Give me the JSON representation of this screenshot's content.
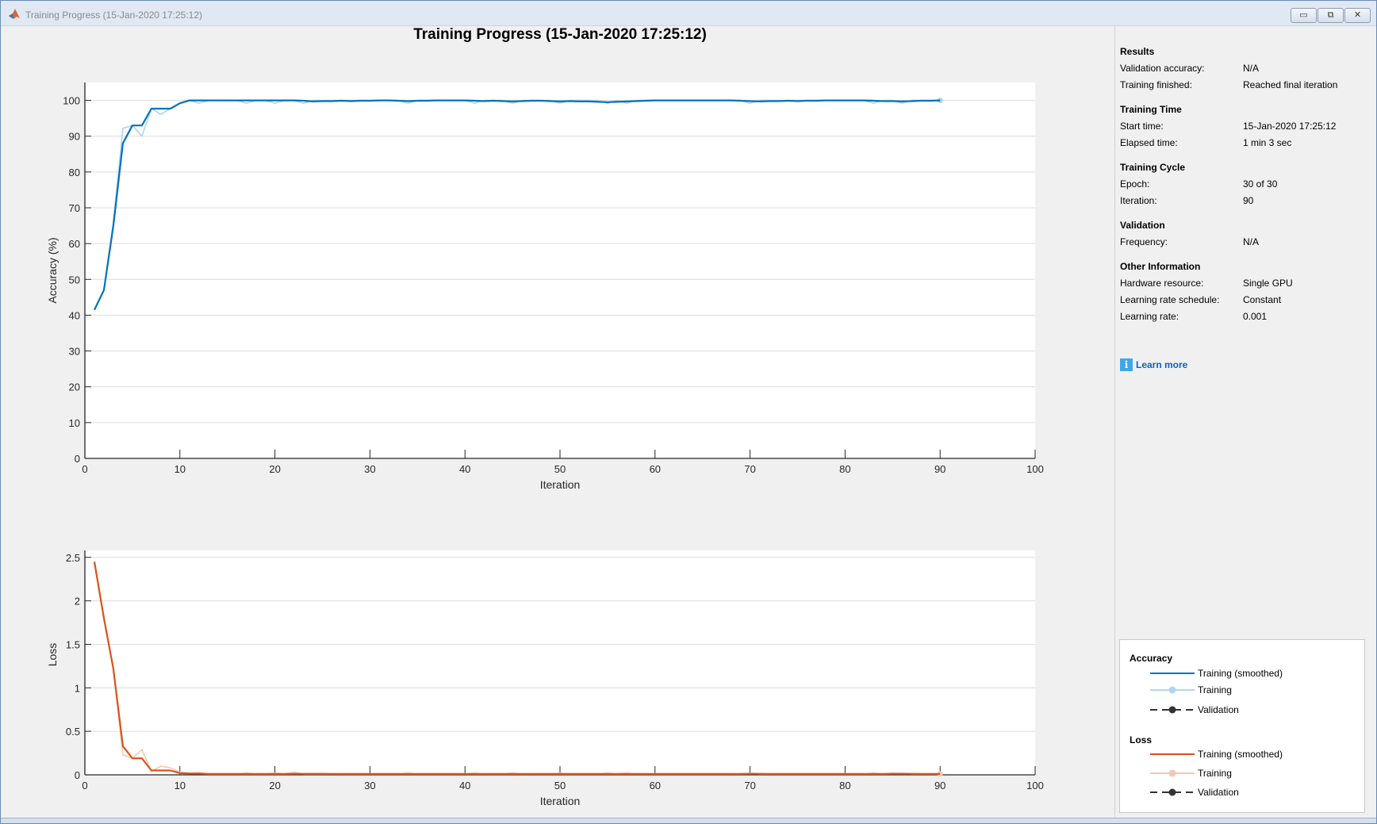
{
  "window": {
    "title": "Training Progress (15-Jan-2020 17:25:12)",
    "buttons": {
      "minimize": "▭",
      "restore": "⧉",
      "close": "✕"
    }
  },
  "main_title": "Training Progress (15-Jan-2020 17:25:12)",
  "info": {
    "sections": [
      {
        "title": "Results",
        "rows": [
          {
            "label": "Validation accuracy:",
            "value": "N/A"
          },
          {
            "label": "Training finished:",
            "value": "Reached final iteration"
          }
        ]
      },
      {
        "title": "Training Time",
        "rows": [
          {
            "label": "Start time:",
            "value": "15-Jan-2020 17:25:12"
          },
          {
            "label": "Elapsed time:",
            "value": "1 min 3 sec"
          }
        ]
      },
      {
        "title": "Training Cycle",
        "rows": [
          {
            "label": "Epoch:",
            "value": "30 of 30"
          },
          {
            "label": "Iteration:",
            "value": "90"
          }
        ]
      },
      {
        "title": "Validation",
        "rows": [
          {
            "label": "Frequency:",
            "value": "N/A"
          }
        ]
      },
      {
        "title": "Other Information",
        "rows": [
          {
            "label": "Hardware resource:",
            "value": "Single GPU"
          },
          {
            "label": "Learning rate schedule:",
            "value": "Constant"
          },
          {
            "label": "Learning rate:",
            "value": "0.001"
          }
        ]
      }
    ],
    "learn_more": "Learn more"
  },
  "legend": {
    "accuracy": {
      "title": "Accuracy",
      "items": [
        "Training (smoothed)",
        "Training",
        "Validation"
      ]
    },
    "loss": {
      "title": "Loss",
      "items": [
        "Training (smoothed)",
        "Training",
        "Validation"
      ]
    }
  },
  "colors": {
    "acc_smooth": "#0072bd",
    "acc_raw": "#b3d4ec",
    "loss_smooth": "#d95319",
    "loss_raw": "#f4c7b2",
    "validation": "#333333"
  },
  "chart_data": [
    {
      "type": "line",
      "xlabel": "Iteration",
      "ylabel": "Accuracy (%)",
      "xlim": [
        0,
        100
      ],
      "ylim": [
        0,
        105
      ],
      "xticks": [
        0,
        10,
        20,
        30,
        40,
        50,
        60,
        70,
        80,
        90,
        100
      ],
      "yticks": [
        0,
        10,
        20,
        30,
        40,
        50,
        60,
        70,
        80,
        90,
        100
      ],
      "grid": "horizontal",
      "series": [
        {
          "name": "Training",
          "color_key": "acc_raw",
          "x_start": 1,
          "values": [
            41.5,
            47,
            66,
            92.2,
            93,
            90,
            97.7,
            96.1,
            97.7,
            99.2,
            100,
            99.2,
            100,
            100,
            100,
            100,
            99.2,
            100,
            100,
            99.2,
            100,
            100,
            99.2,
            100,
            100,
            100,
            100,
            100,
            100,
            100,
            100,
            100,
            100,
            99.2,
            100,
            100,
            100,
            100,
            100,
            100,
            99.2,
            100,
            100,
            100,
            99.2,
            100,
            100,
            100,
            100,
            99.2,
            100,
            100,
            100,
            100,
            99.2,
            100,
            99.2,
            100,
            100,
            100,
            100,
            100,
            100,
            100,
            100,
            100,
            100,
            100,
            100,
            99.2,
            100,
            100,
            100,
            100,
            100,
            100,
            100,
            100,
            100,
            100,
            100,
            100,
            99.2,
            100,
            100,
            99.2,
            100,
            100,
            100,
            100
          ]
        },
        {
          "name": "Training (smoothed)",
          "color_key": "acc_smooth",
          "x_start": 1,
          "values": [
            41.5,
            47,
            65,
            88,
            93,
            93,
            97.7,
            97.7,
            97.7,
            99.2,
            100,
            100,
            100,
            100,
            100,
            100,
            100,
            100,
            100,
            100,
            100,
            100,
            99.9,
            99.7,
            99.8,
            99.8,
            99.9,
            99.8,
            99.9,
            99.9,
            100,
            100,
            99.9,
            99.8,
            99.9,
            99.9,
            100,
            100,
            100,
            100,
            99.9,
            99.8,
            99.9,
            99.8,
            99.7,
            99.8,
            99.9,
            99.9,
            99.8,
            99.7,
            99.8,
            99.7,
            99.7,
            99.6,
            99.5,
            99.6,
            99.7,
            99.8,
            99.9,
            100,
            100,
            100,
            100,
            100,
            100,
            100,
            100,
            100,
            99.9,
            99.8,
            99.7,
            99.8,
            99.8,
            99.9,
            99.8,
            99.9,
            99.9,
            100,
            100,
            100,
            100,
            100,
            99.9,
            99.8,
            99.8,
            99.7,
            99.8,
            99.9,
            99.9,
            100
          ]
        }
      ]
    },
    {
      "type": "line",
      "xlabel": "Iteration",
      "ylabel": "Loss",
      "xlim": [
        0,
        100
      ],
      "ylim": [
        0,
        2.58
      ],
      "xticks": [
        0,
        10,
        20,
        30,
        40,
        50,
        60,
        70,
        80,
        90,
        100
      ],
      "yticks": [
        0,
        0.5,
        1,
        1.5,
        2,
        2.5
      ],
      "grid": "horizontal",
      "series": [
        {
          "name": "Training",
          "color_key": "loss_raw",
          "x_start": 1,
          "values": [
            2.45,
            1.8,
            1.22,
            0.23,
            0.19,
            0.29,
            0.04,
            0.1,
            0.08,
            0.03,
            0.02,
            0.025,
            0.01,
            0.01,
            0.01,
            0.01,
            0.02,
            0.01,
            0.01,
            0.02,
            0.01,
            0.03,
            0.01,
            0.01,
            0.01,
            0.01,
            0.01,
            0.01,
            0.01,
            0.01,
            0.01,
            0.01,
            0.01,
            0.02,
            0.01,
            0.01,
            0.01,
            0.01,
            0.01,
            0.01,
            0.02,
            0.01,
            0.01,
            0.01,
            0.02,
            0.01,
            0.01,
            0.01,
            0.01,
            0.02,
            0.01,
            0.01,
            0.01,
            0.01,
            0.02,
            0.01,
            0.02,
            0.01,
            0.01,
            0.01,
            0.01,
            0.01,
            0.01,
            0.01,
            0.01,
            0.01,
            0.01,
            0.01,
            0.01,
            0.02,
            0.01,
            0.01,
            0.01,
            0.01,
            0.01,
            0.01,
            0.01,
            0.01,
            0.01,
            0.01,
            0.01,
            0.01,
            0.02,
            0.01,
            0.02,
            0.02,
            0.01,
            0.01,
            0.01,
            0.01
          ]
        },
        {
          "name": "Training (smoothed)",
          "color_key": "loss_smooth",
          "x_start": 1,
          "values": [
            2.45,
            1.8,
            1.22,
            0.33,
            0.19,
            0.19,
            0.05,
            0.05,
            0.05,
            0.02,
            0.015,
            0.015,
            0.01,
            0.01,
            0.01,
            0.01,
            0.01,
            0.01,
            0.01,
            0.01,
            0.01,
            0.012,
            0.012,
            0.012,
            0.012,
            0.011,
            0.01,
            0.01,
            0.01,
            0.01,
            0.01,
            0.01,
            0.01,
            0.01,
            0.01,
            0.01,
            0.01,
            0.01,
            0.01,
            0.01,
            0.01,
            0.01,
            0.01,
            0.01,
            0.01,
            0.01,
            0.01,
            0.01,
            0.01,
            0.01,
            0.01,
            0.01,
            0.01,
            0.01,
            0.01,
            0.01,
            0.01,
            0.01,
            0.01,
            0.01,
            0.01,
            0.01,
            0.01,
            0.01,
            0.01,
            0.01,
            0.01,
            0.01,
            0.01,
            0.012,
            0.012,
            0.01,
            0.01,
            0.01,
            0.01,
            0.01,
            0.01,
            0.01,
            0.01,
            0.01,
            0.01,
            0.01,
            0.01,
            0.01,
            0.012,
            0.012,
            0.012,
            0.01,
            0.01,
            0.01
          ]
        }
      ]
    }
  ]
}
